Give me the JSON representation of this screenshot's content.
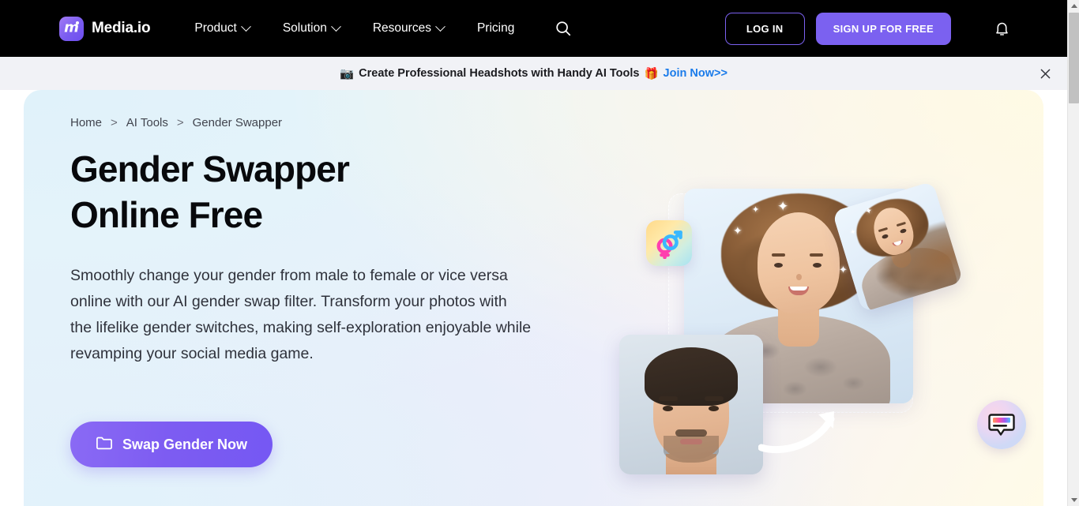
{
  "header": {
    "brand": {
      "name": "Media.io",
      "mark_letter": "m"
    },
    "nav": [
      {
        "label": "Product",
        "has_caret": true
      },
      {
        "label": "Solution",
        "has_caret": true
      },
      {
        "label": "Resources",
        "has_caret": true
      },
      {
        "label": "Pricing",
        "has_caret": false
      }
    ],
    "search_icon": "search-icon",
    "login_label": "LOG IN",
    "signup_label": "SIGN UP FOR FREE",
    "bell_icon": "bell-icon",
    "accent_purple": "#7b61f0",
    "background": "#000000"
  },
  "promo": {
    "camera_emoji": "📷",
    "text": "Create Professional Headshots with Handy AI Tools",
    "gift_emoji": "🎁",
    "link": "Join Now>>",
    "link_color": "#1a7bea",
    "close_icon": "close-icon",
    "background": "#f1f2f6"
  },
  "hero": {
    "breadcrumb": [
      {
        "label": "Home",
        "current": false
      },
      {
        "label": "AI Tools",
        "current": false
      },
      {
        "label": "Gender Swapper",
        "current": true
      }
    ],
    "breadcrumb_separator": ">",
    "title": "Gender Swapper\nOnline Free",
    "description": "Smoothly change your gender from male to female or vice versa online with our AI gender swap filter. Transform your photos with the lifelike gender switches, making self-exploration enjoyable while revamping your social media game.",
    "cta": {
      "label": "Swap Gender Now",
      "icon": "folder-icon",
      "gradient_from": "#8a6af4",
      "gradient_to": "#7558f3"
    },
    "art": {
      "badge_icon": "gender-symbols-icon",
      "main_card": "female-portrait-image",
      "thumb_card": "female-portrait-thumbnail-image",
      "male_card": "male-portrait-image",
      "arrow_icon": "curved-arrow-icon"
    }
  },
  "chat": {
    "icon": "chat-bubble-icon",
    "label": "Chat support"
  },
  "scrollbar": {
    "up_icon": "scroll-up-arrow",
    "down_icon": "scroll-down-arrow",
    "thumb": "scrollbar-thumb"
  }
}
